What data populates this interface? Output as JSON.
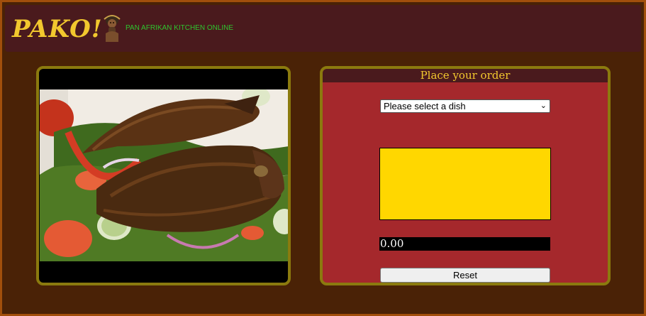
{
  "header": {
    "logo_text": "PAKO!",
    "tagline": "PAN AFRIKAN KITCHEN ONLINE"
  },
  "order": {
    "title": "Place your order",
    "dish_select": {
      "selected": "Please select a dish"
    },
    "price_display": "0.00",
    "reset_label": "Reset"
  },
  "colors": {
    "page_background": "#4a2206",
    "header_background": "#4a1a1d",
    "logo": "#f2c82e",
    "tagline": "#2fc42f",
    "panel_border": "#8b7a0e",
    "order_panel": "#a5282c",
    "dish_display": "#ffd700"
  },
  "icons": {
    "logo_figure": "pako-mascot-icon",
    "select_arrow": "chevron-down-icon"
  }
}
